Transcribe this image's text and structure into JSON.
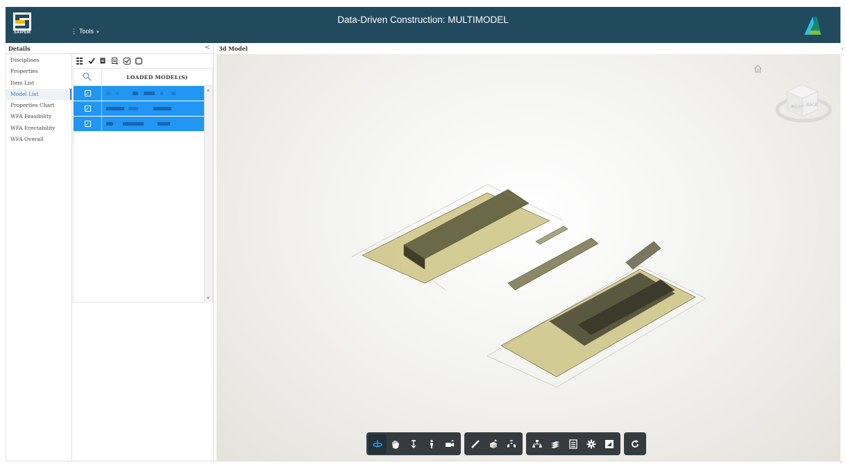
{
  "header": {
    "title": "Data-Driven Construction: MULTIMODEL",
    "logo_text": "SAIPEM",
    "tools_label": "Tools",
    "bg": "#224a5e"
  },
  "left_panel": {
    "title": "Details",
    "collapse_glyph": "<",
    "nav": [
      {
        "label": "Disciplines"
      },
      {
        "label": "Properties"
      },
      {
        "label": "Item List"
      },
      {
        "label": "Model List"
      },
      {
        "label": "Properties Chart"
      },
      {
        "label": "WFA Feasibility"
      },
      {
        "label": "WFA Erectability"
      },
      {
        "label": "WFA Overall"
      }
    ],
    "active_item": "Model List",
    "toolbar_icons": [
      "grid-icon",
      "checkmark-icon",
      "document-icon",
      "document-list-icon",
      "check-square-icon",
      "square-icon"
    ],
    "grid": {
      "column_header": "LOADED MODEL(S)",
      "rows": [
        {
          "checked": true,
          "name": "[redacted]"
        },
        {
          "checked": true,
          "name": "[redacted]"
        },
        {
          "checked": true,
          "name": "[redacted]"
        }
      ],
      "row_color": "#2196f3"
    }
  },
  "viewer": {
    "title": "3d Model",
    "toolbar_groups": [
      [
        "orbit-icon",
        "pan-icon",
        "dolly-icon",
        "first-person-icon",
        "camera-icon"
      ],
      [
        "measure-icon",
        "section-icon",
        "explode-icon"
      ],
      [
        "model-browser-icon",
        "layers-icon",
        "properties-icon",
        "settings-icon",
        "fullscreen-icon"
      ],
      [
        "reset-icon"
      ]
    ]
  }
}
